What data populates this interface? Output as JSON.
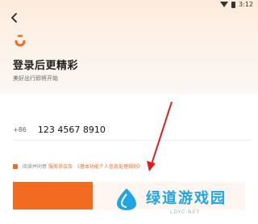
{
  "status_bar": {
    "time": "3:12"
  },
  "header": {
    "title": "登录后更精彩",
    "subtitle": "美好出行即将开始"
  },
  "phone": {
    "country_code": "+86",
    "value": "123 4567 8910"
  },
  "agreement": {
    "prefix": "阅读并同意",
    "terms_link": "服务协议及",
    "privacy_link": "《基本功能个人信息处理规则》"
  },
  "watermark": {
    "name": "绿道游戏园",
    "site": "LDYC.NET"
  },
  "colors": {
    "accent": "#f26b21",
    "watermark_blue": "#1fa5e6"
  },
  "icons": [
    "back-arrow-icon",
    "didi-logo-icon",
    "wifi-icon",
    "battery-icon",
    "annotation-arrow"
  ]
}
